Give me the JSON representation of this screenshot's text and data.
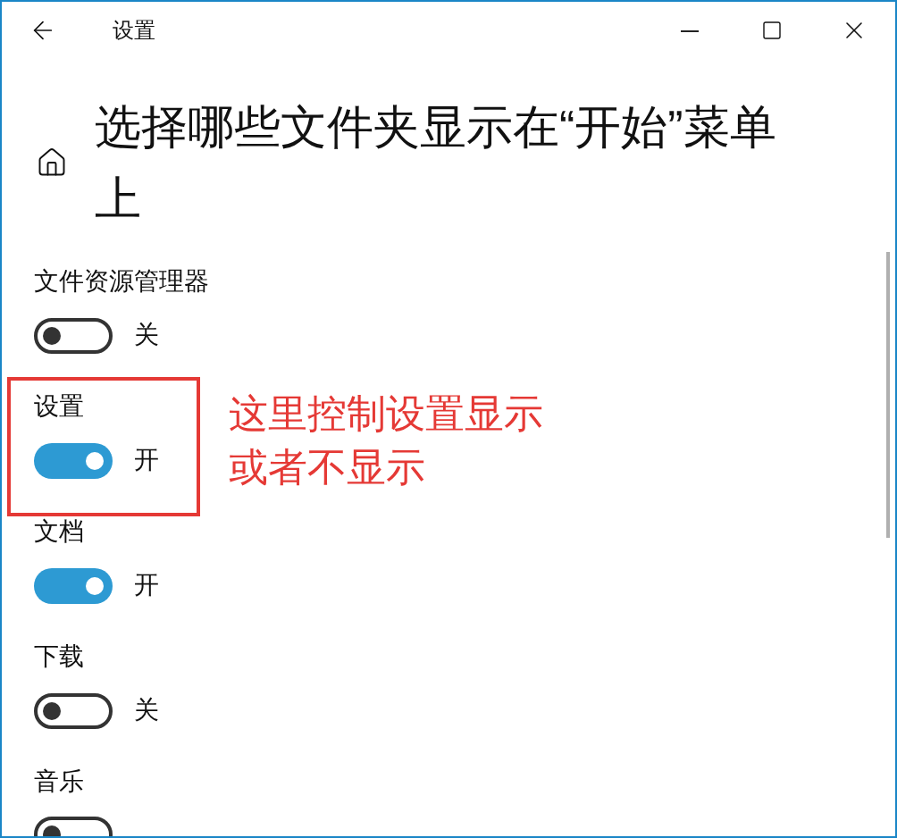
{
  "window": {
    "title": "设置"
  },
  "heading": "选择哪些文件夹显示在“开始”菜单上",
  "items": [
    {
      "label": "文件资源管理器",
      "on": false,
      "state_text": "关",
      "highlighted": false
    },
    {
      "label": "设置",
      "on": true,
      "state_text": "开",
      "highlighted": true,
      "annotation": [
        "这里控制设置显示",
        "或者不显示"
      ]
    },
    {
      "label": "文档",
      "on": true,
      "state_text": "开",
      "highlighted": false
    },
    {
      "label": "下载",
      "on": false,
      "state_text": "关",
      "highlighted": false
    },
    {
      "label": "音乐",
      "on": false,
      "highlighted": false
    }
  ]
}
